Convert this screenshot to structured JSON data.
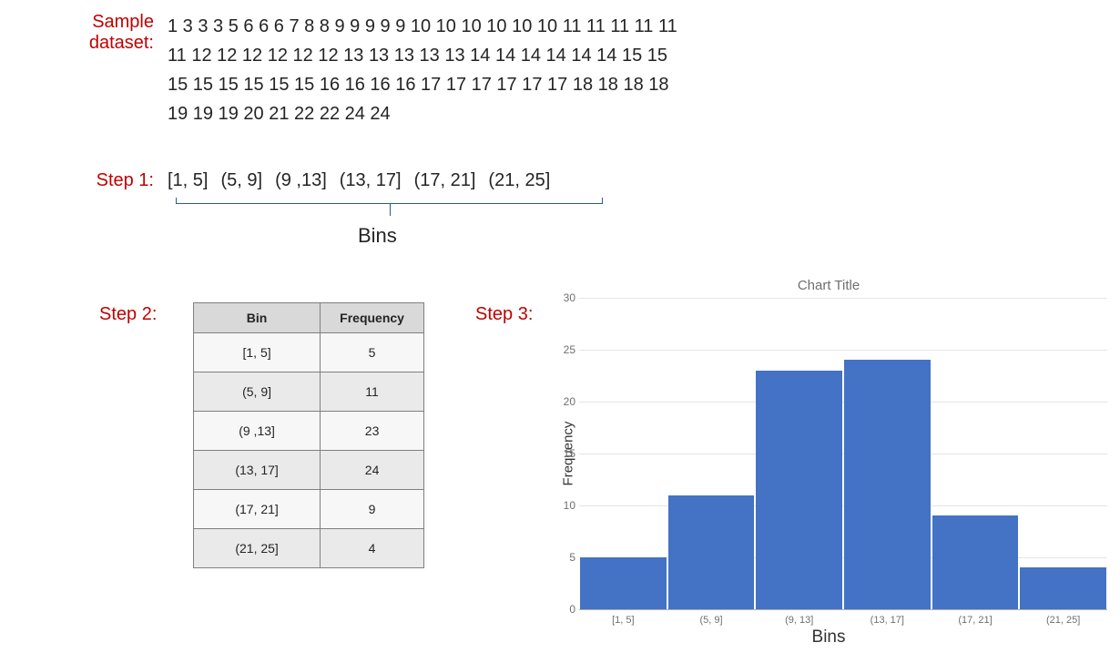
{
  "labels": {
    "sample_dataset": "Sample dataset:",
    "step1": "Step 1:",
    "step2": "Step 2:",
    "step3": "Step 3:",
    "bins": "Bins"
  },
  "dataset_lines": [
    "1 3 3 3 5 6 6 6 7 8 8 9 9 9 9 9 10 10 10 10 10 10 11 11 11 11 11",
    "11 12 12 12 12 12 12 13 13 13 13 13 14 14 14 14 14 14 15 15",
    "15 15 15 15 15 15 16 16 16 16 17 17 17 17 17 17 18 18 18 18",
    "19 19 19 20 21 22 22 24 24"
  ],
  "step1_bins": [
    "[1, 5]",
    "(5, 9]",
    "(9 ,13]",
    "(13, 17]",
    "(17, 21]",
    "(21, 25]"
  ],
  "table": {
    "headers": {
      "bin": "Bin",
      "freq": "Frequency"
    },
    "rows": [
      {
        "bin": "[1, 5]",
        "freq": "5"
      },
      {
        "bin": "(5, 9]",
        "freq": "11"
      },
      {
        "bin": "(9 ,13]",
        "freq": "23"
      },
      {
        "bin": "(13, 17]",
        "freq": "24"
      },
      {
        "bin": "(17, 21]",
        "freq": "9"
      },
      {
        "bin": "(21, 25]",
        "freq": "4"
      }
    ]
  },
  "chart_data": {
    "type": "bar",
    "title": "Chart Title",
    "xlabel": "Bins",
    "ylabel": "Frequency",
    "ylim": [
      0,
      30
    ],
    "y_ticks": [
      0,
      5,
      10,
      15,
      20,
      25,
      30
    ],
    "categories": [
      "[1, 5]",
      "(5, 9]",
      "(9, 13]",
      "(13, 17]",
      "(17, 21]",
      "(21, 25]"
    ],
    "values": [
      5,
      11,
      23,
      24,
      9,
      4
    ],
    "bar_color": "#4472c4"
  }
}
